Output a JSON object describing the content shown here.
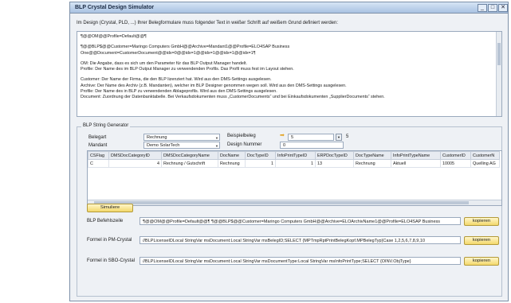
{
  "window": {
    "title": "BLP Crystal Design Simulator",
    "buttons": [
      "_",
      "□",
      "✕"
    ]
  },
  "intro": "Im Design (Crystal, PLD, ...) Ihrer Belegformulare muss folgender Text in weißer Schrift auf weißem Grund definiert werden:",
  "textbox": {
    "lines": [
      "¶@@OM@@Profile=Default@@¶",
      "",
      "¶@@BLP$@@Customer=Maringo Computers GmbH@@Archive=Mandant1@@Profile=ELO4SAP Business",
      "One@@Document=CustomerDocument@@idx=0@@idx=1@@idx=1@@idx=1@@idx=1¶",
      "",
      "OM: Die Angabe, dass es sich um den Parameter für das BLP Output Manager handelt.",
      "Profile: Der Name des im BLP Output Manager zu verwendenden Profils. Das Profil muss fest im Layout stehen.",
      "",
      "Customer: Der Name der Firma, die den BLP lizenziert hat. Wird aus den DMS-Settings ausgelesen.",
      "Archive: Der Name des Archiv (z.B. Mandanten), welcher im BLP Designer genommen wegen soll. Wird aus den DMS-Settings ausgelesen.",
      "Profile: Der Name des in BLP zu verwendenden Ablageprofils. Wird aus den DMS-Settings ausgelesen.",
      "Document: Zuordnung der Datenbanktabelle. Bei Verkaufsdokumenten muss „CustomerDocuments“ und bei Einkaufsdokumenten „SupplierDocuments“ stehen."
    ]
  },
  "generator": {
    "group_label": "BLP String Generator",
    "belegart_label": "Belegart",
    "belegart_value": "Rechnung",
    "mandant_label": "Mandant",
    "mandant_value": "Demo SolarTech",
    "beispielbeleg_label": "Beispielbeleg",
    "beispielbeleg_value": "5",
    "beispielbeleg_count": "5",
    "design_nummer_label": "Design Nummer",
    "design_nummer_value": "0"
  },
  "grid": {
    "columns": [
      "CSFlag",
      "DMSDocCategoryID",
      "DMSDocCategoryName",
      "DocName",
      "DocTypeID",
      "InfoPrintTypeID",
      "ERPDocTypeID",
      "DocTypeName",
      "InfoPrintTypeName",
      "CustomerID",
      "CustomerN"
    ],
    "rows": [
      [
        "C",
        "4",
        "Rechnung / Gutschrift",
        "Rechnung",
        "1",
        "1",
        "13",
        "Rechnung",
        "Aktuell",
        "10005",
        "Quelling AG"
      ]
    ]
  },
  "simulate_button": "Simuliere",
  "outputs": {
    "befehlszeile_label": "BLP Befehlszeile",
    "befehlszeile_value": "¶@@OM@@Profile=Default@@¶ ¶@@BLP$@@Customer=Maringo Computers GmbH@@Archive=ELOArchivName1@@Profile=ELO4SAP Business",
    "pmcrystal_label": "Formel in PM-Crystal",
    "pmcrystal_value": "//BLPLicenseIDLocal StringVar msDocument:Local StringVar msBelegID;SELECT {MPTmpRptPrintBelegKopf.MPBelegTyp}Case 1,2,5,6,7,8,9,10",
    "sbocrystal_label": "Formel in SBO-Crystal",
    "sbocrystal_value": "//BLPLicenseIDLocal StringVar msDocument:Local StringVar msDocumentType:Local StringVar msInfoPrintType;SELECT {OINV.ObjType}",
    "copy_label": "kopieren"
  }
}
